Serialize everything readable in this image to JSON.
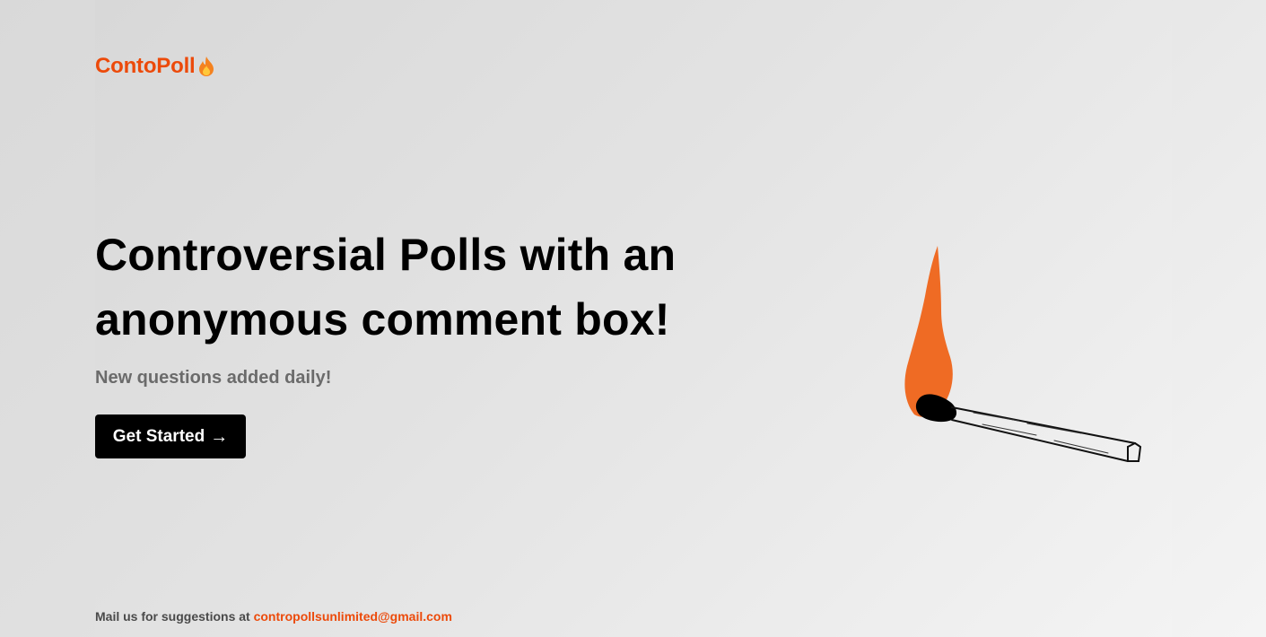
{
  "brand": {
    "name": "ContoPoll",
    "icon": "fire-icon",
    "color": "#ec4a0a"
  },
  "hero": {
    "headline_line1": "Controversial Polls with an",
    "headline_line2": "anonymous comment box!",
    "subtitle": "New questions added daily!",
    "cta_label": "Get Started",
    "cta_arrow": "→"
  },
  "footer": {
    "prefix": "Mail us for suggestions at",
    "email": "contropollsunlimited@gmail.com"
  },
  "illustration": {
    "icon": "burning-match-icon",
    "flame_color": "#ef6b24"
  }
}
